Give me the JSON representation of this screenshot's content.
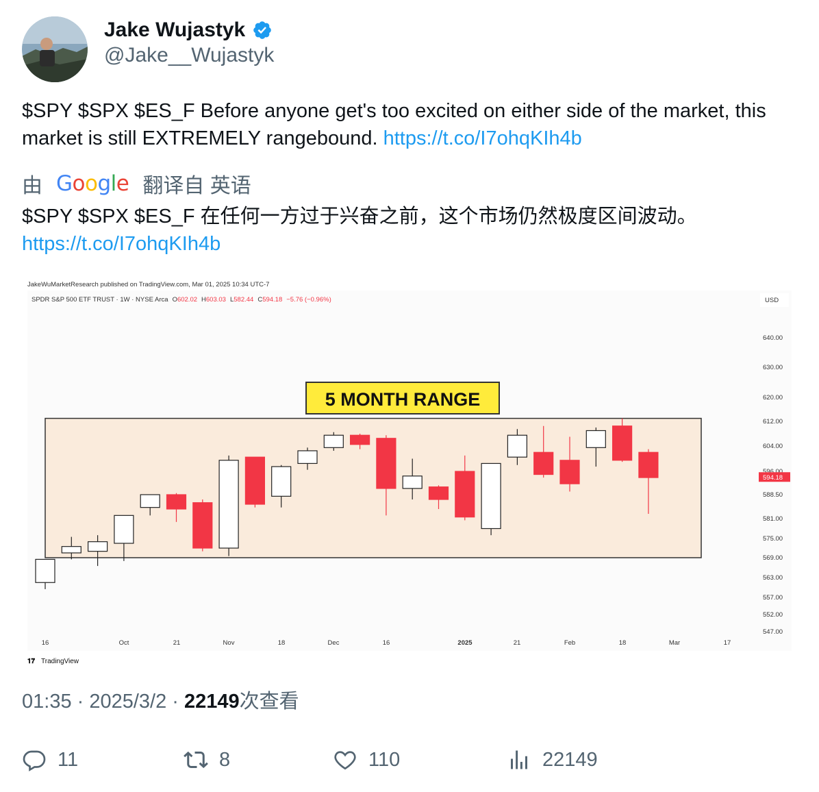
{
  "author": {
    "name": "Jake Wujastyk",
    "handle": "@Jake__Wujastyk"
  },
  "tweet": {
    "text": "$SPY $SPX $ES_F Before anyone get's too excited on either side of the market, this market is still EXTREMELY rangebound. ",
    "link": "https://t.co/I7ohqKIh4b"
  },
  "translation": {
    "prefix": "由",
    "provider": "Google",
    "suffix": "翻译自 英语",
    "text": "$SPY $SPX $ES_F 在任何一方过于兴奋之前，这个市场仍然极度区间波动。",
    "link": "https://t.co/I7ohqKIh4b"
  },
  "chart_data": {
    "type": "candlestick",
    "published": "JakeWuMarketResearch published on TradingView.com, Mar 01, 2025 10:34 UTC-7",
    "symbol_info": "SPDR S&P 500 ETF TRUST · 1W · NYSE Arca",
    "ohlc": {
      "o_label": "O",
      "o": "602.02",
      "h_label": "H",
      "h": "603.03",
      "l_label": "L",
      "l": "582.44",
      "c_label": "C",
      "c": "594.18",
      "change": "−5.76 (−0.96%)"
    },
    "currency": "USD",
    "annotation": "5 MONTH RANGE",
    "range_box": [
      569,
      613
    ],
    "y_ticks": [
      "640.00",
      "630.00",
      "620.00",
      "612.00",
      "604.00",
      "596.00",
      "588.50",
      "581.00",
      "575.00",
      "569.00",
      "563.00",
      "557.00",
      "552.00",
      "547.00"
    ],
    "last_price_label": "594.18",
    "x_ticks": [
      "16",
      "Oct",
      "21",
      "Nov",
      "18",
      "Dec",
      "16",
      "2025",
      "21",
      "Feb",
      "18",
      "Mar",
      "17"
    ],
    "watermark": "TradingView",
    "candles": [
      {
        "o": 561.5,
        "h": 567.5,
        "l": 559.5,
        "c": 568.5
      },
      {
        "o": 570.5,
        "h": 575.5,
        "l": 568.5,
        "c": 572.5
      },
      {
        "o": 571.0,
        "h": 576.0,
        "l": 566.5,
        "c": 574.0
      },
      {
        "o": 573.5,
        "h": 582.0,
        "l": 568.0,
        "c": 582.0
      },
      {
        "o": 584.5,
        "h": 588.0,
        "l": 582.0,
        "c": 588.5
      },
      {
        "o": 588.5,
        "h": 589.0,
        "l": 580.0,
        "c": 584.0
      },
      {
        "o": 586.0,
        "h": 587.0,
        "l": 571.0,
        "c": 572.0
      },
      {
        "o": 572.0,
        "h": 601.0,
        "l": 569.5,
        "c": 599.5
      },
      {
        "o": 600.5,
        "h": 600.5,
        "l": 584.5,
        "c": 585.5
      },
      {
        "o": 588.0,
        "h": 598.0,
        "l": 584.5,
        "c": 597.5
      },
      {
        "o": 598.5,
        "h": 603.5,
        "l": 596.5,
        "c": 602.5
      },
      {
        "o": 603.5,
        "h": 608.5,
        "l": 602.5,
        "c": 607.5
      },
      {
        "o": 607.5,
        "h": 608.0,
        "l": 603.0,
        "c": 604.5
      },
      {
        "o": 606.5,
        "h": 607.5,
        "l": 582.0,
        "c": 590.5
      },
      {
        "o": 590.5,
        "h": 600.0,
        "l": 587.0,
        "c": 594.5
      },
      {
        "o": 591.0,
        "h": 591.5,
        "l": 584.0,
        "c": 587.0
      },
      {
        "o": 596.0,
        "h": 601.0,
        "l": 580.5,
        "c": 581.5
      },
      {
        "o": 578.0,
        "h": 598.0,
        "l": 576.0,
        "c": 598.5
      },
      {
        "o": 600.5,
        "h": 609.5,
        "l": 598.0,
        "c": 607.5
      },
      {
        "o": 602.0,
        "h": 610.5,
        "l": 594.0,
        "c": 595.0
      },
      {
        "o": 599.5,
        "h": 607.0,
        "l": 589.5,
        "c": 592.0
      },
      {
        "o": 603.5,
        "h": 610.0,
        "l": 597.5,
        "c": 609.0
      },
      {
        "o": 610.5,
        "h": 613.0,
        "l": 599.0,
        "c": 599.5
      },
      {
        "o": 602.0,
        "h": 603.0,
        "l": 582.5,
        "c": 594.0
      }
    ],
    "colors": {
      "up": "#ffffff",
      "down": "#f23645",
      "range_fill": "#faebdc",
      "annotation_bg": "#ffeb3b"
    }
  },
  "meta": {
    "time": "01:35 · 2025/3/2 · ",
    "views_count": "22149",
    "views_label": "次查看"
  },
  "actions": {
    "reply": "11",
    "retweet": "8",
    "like": "110",
    "views": "22149"
  }
}
